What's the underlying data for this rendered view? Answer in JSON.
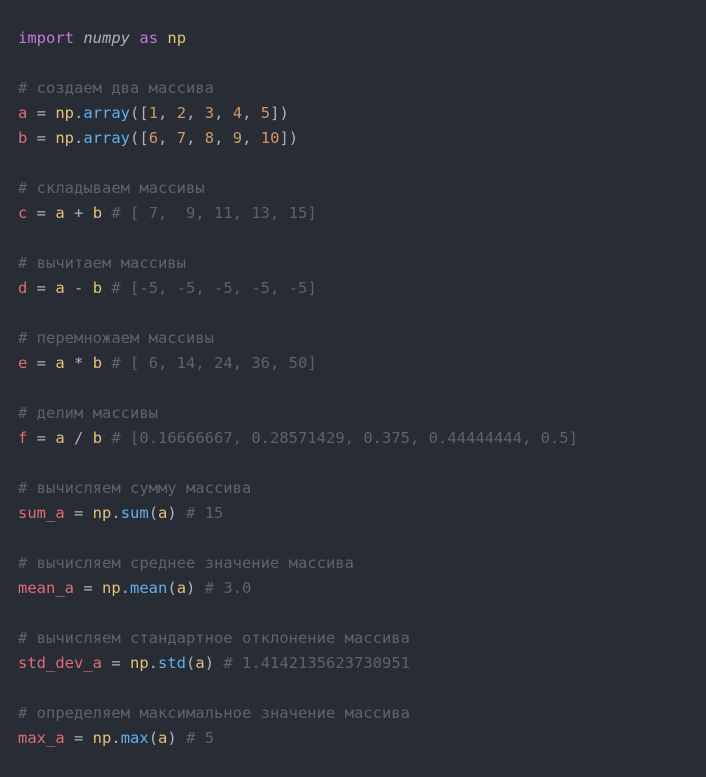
{
  "code": {
    "import_kw": "import",
    "numpy": "numpy",
    "as_kw": "as",
    "np_alias": "np",
    "c_create_arrays": "# создаем два массива",
    "a": "a",
    "b": "b",
    "eq": " = ",
    "np": "np",
    "dot": ".",
    "array": "array",
    "lp_lb": "([",
    "rb_rp": "])",
    "comma_sp": ", ",
    "n1": "1",
    "n2": "2",
    "n3": "3",
    "n4": "4",
    "n5": "5",
    "n6": "6",
    "n7": "7",
    "n8": "8",
    "n9": "9",
    "n10": "10",
    "c_add": "# складываем массивы",
    "c": "c",
    "plus": " + ",
    "c_add_res": " # [ 7,  9, 11, 13, 15]",
    "c_sub": "# вычитаем массивы",
    "d": "d",
    "minus": " - ",
    "c_sub_res": " # [-5, -5, -5, -5, -5]",
    "c_mul": "# перемножаем массивы",
    "e": "e",
    "mul": " * ",
    "c_mul_res": " # [ 6, 14, 24, 36, 50]",
    "c_div": "# делим массивы",
    "f": "f",
    "div": " / ",
    "c_div_res": " # [0.16666667, 0.28571429, 0.375, 0.44444444, 0.5]",
    "c_sum": "# вычисляем сумму массива",
    "sum_a": "sum_a",
    "sum_fn": "sum",
    "lp": "(",
    "rp": ")",
    "c_sum_res": " # 15",
    "c_mean": "# вычисляем среднее значение массива",
    "mean_a": "mean_a",
    "mean_fn": "mean",
    "c_mean_res": " # 3.0",
    "c_std": "# вычисляем стандартное отклонение массива",
    "std_dev_a": "std_dev_a",
    "std_fn": "std",
    "c_std_res": " # 1.4142135623730951",
    "c_max": "# определяем максимальное значение массива",
    "max_a": "max_a",
    "max_fn": "max",
    "c_max_res": " # 5"
  }
}
